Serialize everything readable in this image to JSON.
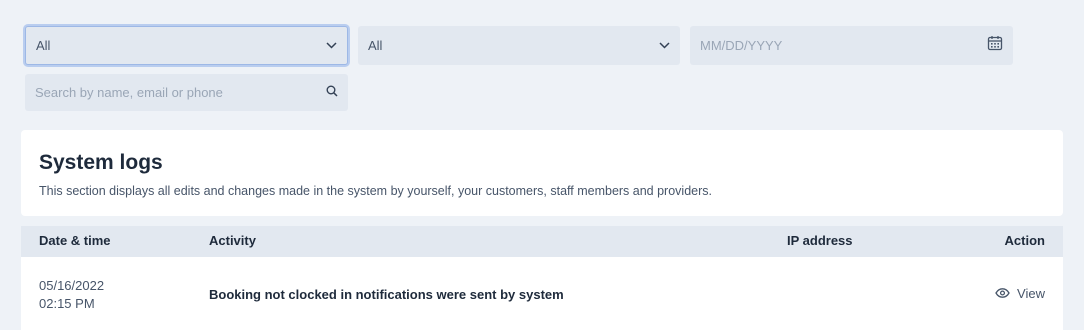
{
  "filters": {
    "filter1_value": "All",
    "filter2_value": "All",
    "date_placeholder": "MM/DD/YYYY",
    "search_placeholder": "Search by name, email or phone"
  },
  "header": {
    "title": "System logs",
    "description": "This section displays all edits and changes made in the system by yourself, your customers, staff members and providers."
  },
  "table": {
    "columns": {
      "datetime": "Date & time",
      "activity": "Activity",
      "ip": "IP address",
      "action": "Action"
    },
    "rows": [
      {
        "date": "05/16/2022",
        "time": "02:15 PM",
        "activity": "Booking not clocked in notifications were sent by system",
        "ip": "",
        "action": "View"
      }
    ]
  },
  "icons": {
    "chevron": "chevron-down-icon",
    "calendar": "calendar-icon",
    "search": "search-icon",
    "view": "eye-icon"
  },
  "colors": {
    "background": "#eef2f7",
    "field_bg": "#e2e8f0",
    "focus_ring": "#b9cdef",
    "text_dark": "#1e2a3b",
    "text_muted": "#475569"
  }
}
